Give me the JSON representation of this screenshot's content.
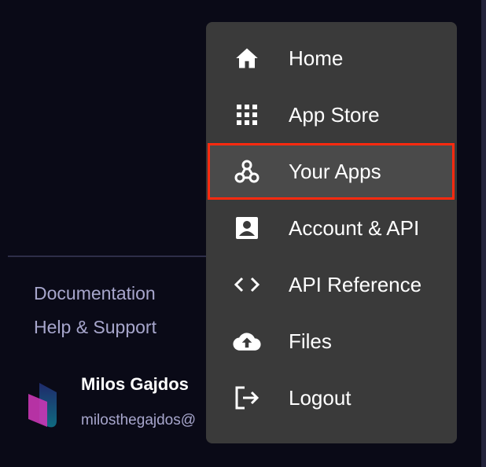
{
  "sidebar": {
    "links": [
      "Documentation",
      "Help & Support"
    ],
    "user": {
      "name": "Milos Gajdos",
      "email": "milosthegajdos@"
    }
  },
  "menu": {
    "items": [
      {
        "label": "Home",
        "icon": "home-icon"
      },
      {
        "label": "App Store",
        "icon": "grid-icon"
      },
      {
        "label": "Your Apps",
        "icon": "webhook-icon",
        "active": true
      },
      {
        "label": "Account & API",
        "icon": "account-icon"
      },
      {
        "label": "API Reference",
        "icon": "code-icon"
      },
      {
        "label": "Files",
        "icon": "cloud-upload-icon"
      },
      {
        "label": "Logout",
        "icon": "logout-icon"
      }
    ]
  },
  "colors": {
    "highlight": "#ff2a0f",
    "menu_bg": "#3a3a3a",
    "bg": "#0a0a17"
  }
}
